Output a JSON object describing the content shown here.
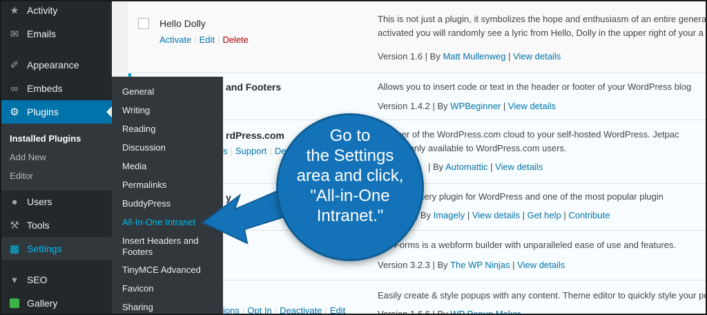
{
  "sidebar": {
    "items": [
      {
        "label": "Activity",
        "icon": "activity-icon"
      },
      {
        "label": "Emails",
        "icon": "envelope-icon"
      },
      {
        "label": "Appearance",
        "icon": "paintbrush-icon"
      },
      {
        "label": "Embeds",
        "icon": "embeds-icon"
      },
      {
        "label": "Plugins",
        "icon": "plugin-icon"
      },
      {
        "label": "Users",
        "icon": "users-icon"
      },
      {
        "label": "Tools",
        "icon": "wrench-icon"
      },
      {
        "label": "Settings",
        "icon": "settings-sliders-icon"
      },
      {
        "label": "SEO",
        "icon": "yoast-icon"
      },
      {
        "label": "Gallery",
        "icon": "gallery-icon"
      }
    ],
    "plugins_submenu": [
      "Installed Plugins",
      "Add New",
      "Editor"
    ]
  },
  "settings_flyout": [
    "General",
    "Writing",
    "Reading",
    "Discussion",
    "Media",
    "Permalinks",
    "BuddyPress",
    "All-In-One Intranet",
    "Insert Headers and Footers",
    "TinyMCE Advanced",
    "Favicon",
    "Sharing"
  ],
  "plugins": {
    "hello_dolly": {
      "name": "Hello Dolly",
      "actions": [
        "Activate",
        "Edit",
        "Delete"
      ],
      "desc1": "This is not just a plugin, it symbolizes the hope and enthusiasm of an entire generat",
      "desc2": "activated you will randomly see a lyric from Hello, Dolly in the upper right of your a",
      "version": "Version 1.6 | By",
      "author": "Matt Mullenweg",
      "view": "View details"
    },
    "insert_headers": {
      "name_tail": "and Footers",
      "desc1": "Allows you to insert code or text in the header or footer of your WordPress blog",
      "version": "Version 1.4.2 | By",
      "author": "WPBeginner",
      "view": "View details"
    },
    "jetpack": {
      "name_tail": "rdPress.com",
      "actions_tail": "s",
      "support": "Support",
      "d": "De",
      "desc1": "e power of the WordPress.com cloud to your self-hosted WordPress. Jetpac",
      "desc2": "ormally only available to WordPress.com users.",
      "version": "| By",
      "author": "Automattic",
      "view": "View details"
    },
    "nextgen": {
      "name_tail": "y",
      "desc1": "popular gallery plugin for WordPress and one of the most popular plugin",
      "version": "2.14 | By",
      "author": "Imagely",
      "view": "View details",
      "help": "Get help",
      "contribute": "Contribute"
    },
    "ninja": {
      "desc1": "inja Forms is a webform builder with unparalleled ease of use and features.",
      "version": "Version 3.2.3 | By",
      "author": "The WP Ninjas",
      "view": "View details"
    },
    "popup": {
      "desc1": "Easily create & style popups with any content. Theme editor to quickly style your pop",
      "version": "Version 1.6.6 | By",
      "author": "WP Popup Maker",
      "actions": [
        "ions",
        "Opt In",
        "Deactivate",
        "Edit"
      ]
    }
  },
  "callout": {
    "lines": [
      "Go to",
      "the Settings",
      "area and click,",
      "\"All-in-One",
      "Intranet.\""
    ],
    "color": "#1473b8"
  }
}
